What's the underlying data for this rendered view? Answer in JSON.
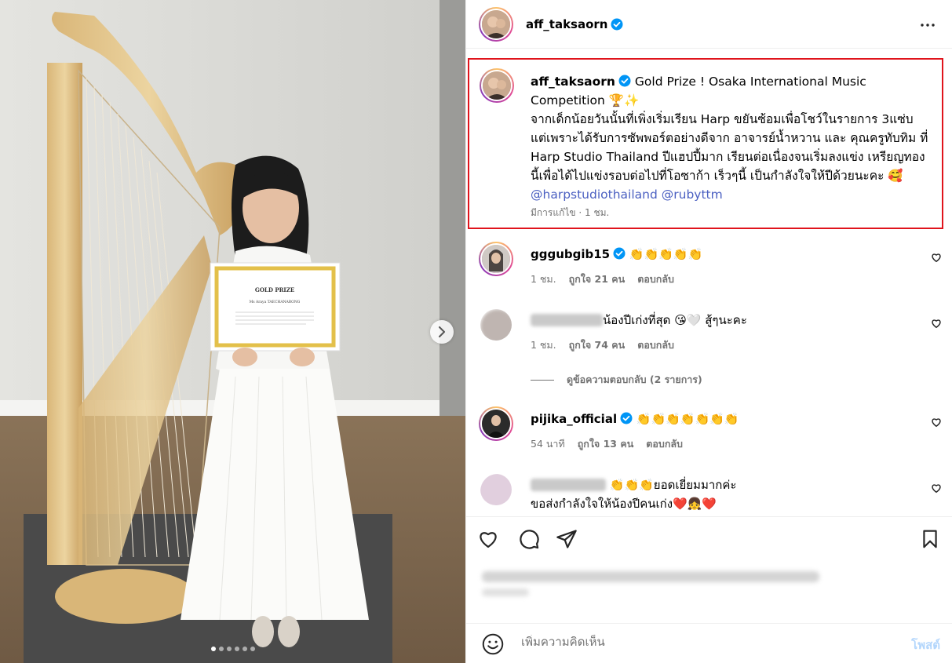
{
  "post": {
    "username": "aff_taksaorn",
    "carousel_dots": 6,
    "carousel_active": 0
  },
  "caption": {
    "username": "aff_taksaorn",
    "line1": "Gold Prize ! Osaka International Music",
    "line2": "Competition 🏆✨",
    "body": "จากเด็กน้อยวันนั้นที่เพิ่งเริ่มเรียน Harp ขยันซ้อมเพื่อโชว์ในรายการ 3แซ่บ แต่เพราะได้รับการซัพพอร์ตอย่างดีจาก อาจารย์น้ำหวาน และ คุณครูทับทิม ที่ Harp Studio Thailand ปีแฮปปี้มาก เรียนต่อเนื่องจนเริ่มลงแข่ง เหรียญทองนี้เพื่อได้ไปแข่งรอบต่อไปที่โอซาก้า เร็วๆนี้ เป็นกำลังใจให้ปีด้วยนะคะ 🥰",
    "mention1": "@harpstudiothailand",
    "mention2": "@rubyttm",
    "meta": "มีการแก้ไข · 1 ชม."
  },
  "comments": [
    {
      "username": "gggubgib15",
      "text": "👏👏👏👏👏",
      "time": "1 ชม.",
      "likes": "ถูกใจ 21 คน",
      "reply": "ตอบกลับ"
    },
    {
      "username": "",
      "text": "น้องปีเก่งที่สุด 😘🤍 สู้ๆนะคะ",
      "time": "1 ชม.",
      "likes": "ถูกใจ 74 คน",
      "reply": "ตอบกลับ"
    },
    {
      "username": "pijika_official",
      "text": "👏👏👏👏👏👏👏",
      "time": "54 นาที",
      "likes": "ถูกใจ 13 คน",
      "reply": "ตอบกลับ"
    },
    {
      "username": "",
      "text": "👏👏👏ยอดเยี่ยมมากค่ะ",
      "text2": "ขอส่งกำลังใจให้น้องปีคนเก่ง❤️👧❤️"
    }
  ],
  "view_replies": "ดูข้อความตอบกลับ (2 รายการ)",
  "comment_box": {
    "placeholder": "เพิ่มความคิดเห็น",
    "post_label": "โพสต์"
  },
  "certificate": {
    "title": "GOLD PRIZE",
    "name": "Ms Araya TAECHANARONG"
  },
  "colors": {
    "verified": "#0095f6",
    "highlight_border": "#e0141c",
    "post_button": "#b3d6fc",
    "mention": "#4a5fc1"
  }
}
